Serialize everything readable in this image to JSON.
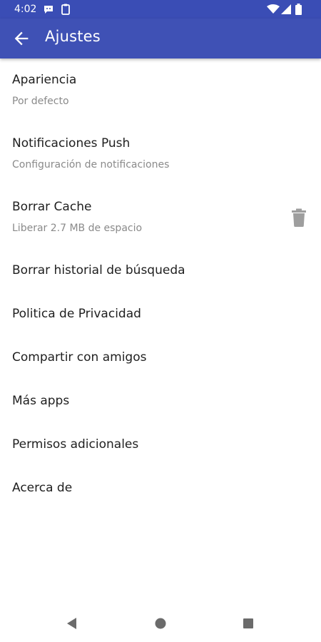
{
  "status_bar": {
    "time": "4:02",
    "icons": [
      "chat-bubble-icon",
      "clipboard-icon",
      "wifi-icon",
      "signal-icon",
      "battery-icon"
    ]
  },
  "app_bar": {
    "title": "Ajustes",
    "back_icon": "arrow-back-icon"
  },
  "colors": {
    "primary": "#3f51b5",
    "status_bar": "#3a4db5",
    "title_text": "#1f1f1f",
    "subtitle_text": "#8a8a8a",
    "icon_gray": "#9e9e9e"
  },
  "settings": {
    "items": [
      {
        "title": "Apariencia",
        "subtitle": "Por defecto"
      },
      {
        "title": "Notificaciones Push",
        "subtitle": "Configuración de notificaciones"
      },
      {
        "title": "Borrar Cache",
        "subtitle": "Liberar 2.7 MB de espacio",
        "icon": "trash-icon"
      },
      {
        "title": "Borrar historial de búsqueda"
      },
      {
        "title": "Politica de Privacidad"
      },
      {
        "title": "Compartir con amigos"
      },
      {
        "title": "Más apps"
      },
      {
        "title": "Permisos adicionales"
      },
      {
        "title": "Acerca de"
      }
    ]
  },
  "nav_bar": {
    "buttons": [
      "back-triangle-icon",
      "home-circle-icon",
      "recents-square-icon"
    ]
  }
}
